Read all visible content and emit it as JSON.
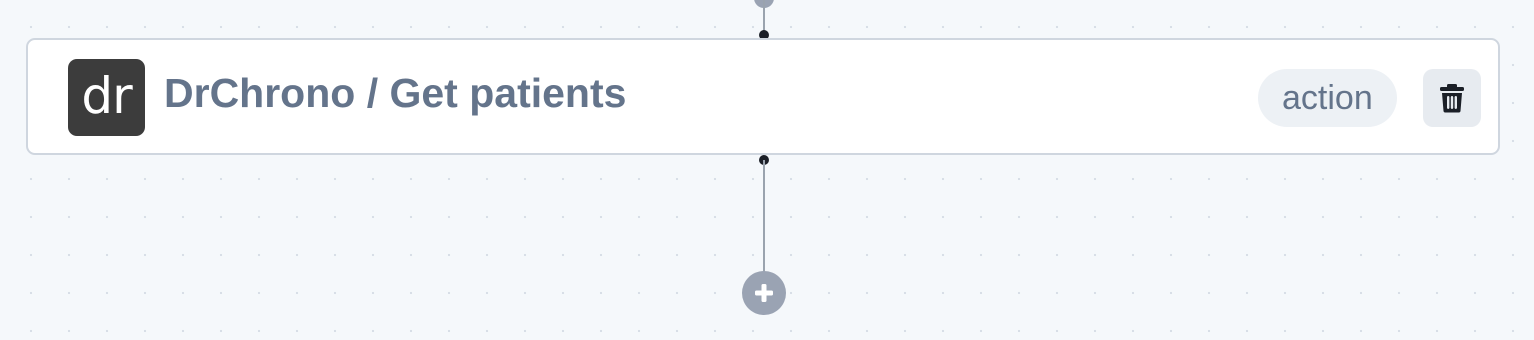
{
  "node": {
    "app_logo_text": "dr",
    "app_logo_color": "#3c3c3c",
    "title": "DrChrono / Get patients",
    "type_badge": "action",
    "delete_icon": "trash-icon"
  },
  "flow": {
    "add_icon": "plus-icon"
  },
  "colors": {
    "canvas_background": "#f5f8fb",
    "title_text": "#64748b",
    "handle": "#1b1f27",
    "add_button": "#9aa3b3"
  }
}
